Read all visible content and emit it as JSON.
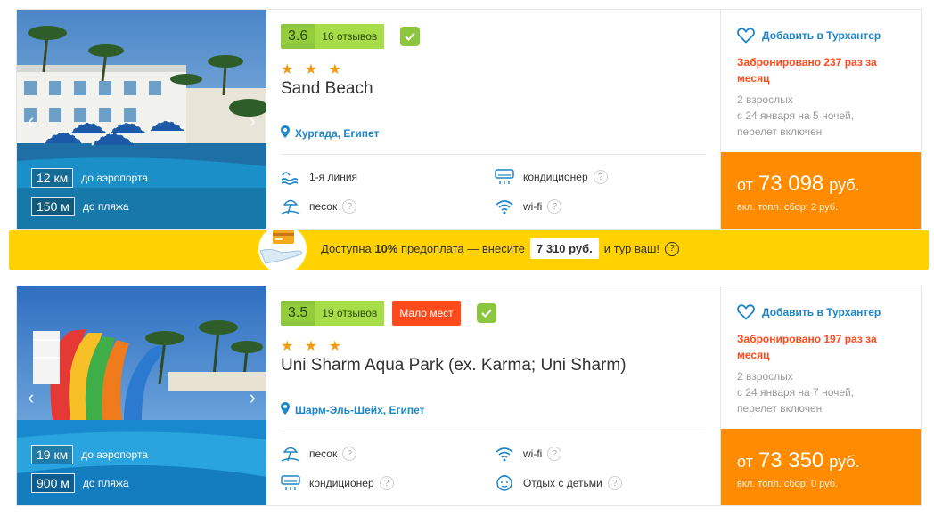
{
  "ui": {
    "check_icon": "check-icon",
    "heart_icon": "heart-outline-icon",
    "pin_icon": "location-pin-icon",
    "colors": {
      "rating": "#8cc63f",
      "accent": "#1d86c8",
      "price_bg": "#ff8c00",
      "alert": "#ff4a1c",
      "banner": "#ffd200"
    }
  },
  "hotels": [
    {
      "score": "3.6",
      "reviews": "16 отзывов",
      "badge": "",
      "stars": "★ ★ ★",
      "name": "Sand Beach",
      "location": "Хургада, Египет",
      "dist_airport_value": "12 км",
      "dist_airport_label": "до аэропорта",
      "dist_beach_value": "150 м",
      "dist_beach_label": "до пляжа",
      "features": [
        {
          "icon": "beach-line-icon",
          "label": "1-я линия"
        },
        {
          "icon": "air-conditioner-icon",
          "label": "кондиционер"
        },
        {
          "icon": "sand-beach-icon",
          "label": "песок"
        },
        {
          "icon": "wifi-icon",
          "label": "wi-fi"
        }
      ],
      "favorite": "Добавить в Турхантер",
      "booked": "Забронировано 237 раз за месяц",
      "desc_line1": "2 взрослых",
      "desc_line2": "с 24 января на 5 ночей,",
      "desc_line3": "перелет включен",
      "price_from": "от",
      "price_amount": "73 098",
      "price_currency": "руб.",
      "price_fee": "вкл. топл. сбор: 2 руб."
    },
    {
      "score": "3.5",
      "reviews": "19 отзывов",
      "badge": "Мало мест",
      "stars": "★ ★ ★",
      "name": "Uni Sharm Aqua Park (ex. Karma; Uni Sharm)",
      "location": "Шарм-Эль-Шейх, Египет",
      "dist_airport_value": "19 км",
      "dist_airport_label": "до аэропорта",
      "dist_beach_value": "900 м",
      "dist_beach_label": "до пляжа",
      "features": [
        {
          "icon": "sand-beach-icon",
          "label": "песок"
        },
        {
          "icon": "wifi-icon",
          "label": "wi-fi"
        },
        {
          "icon": "air-conditioner-icon",
          "label": "кондиционер"
        },
        {
          "icon": "kids-icon",
          "label": "Отдых с детьми"
        }
      ],
      "favorite": "Добавить в Турхантер",
      "booked": "Забронировано 197 раз за месяц",
      "desc_line1": "2 взрослых",
      "desc_line2": "с 24 января на 7 ночей,",
      "desc_line3": "перелет включен",
      "price_from": "от",
      "price_amount": "73 350",
      "price_currency": "руб.",
      "price_fee": "вкл. топл. сбор: 0 руб."
    }
  ],
  "banner": {
    "pre": "Доступна",
    "percent": "10%",
    "mid": "предоплата — внесите",
    "amount": "7 310 руб.",
    "post": "и тур ваш!",
    "help": "?"
  },
  "help_mark": "?"
}
